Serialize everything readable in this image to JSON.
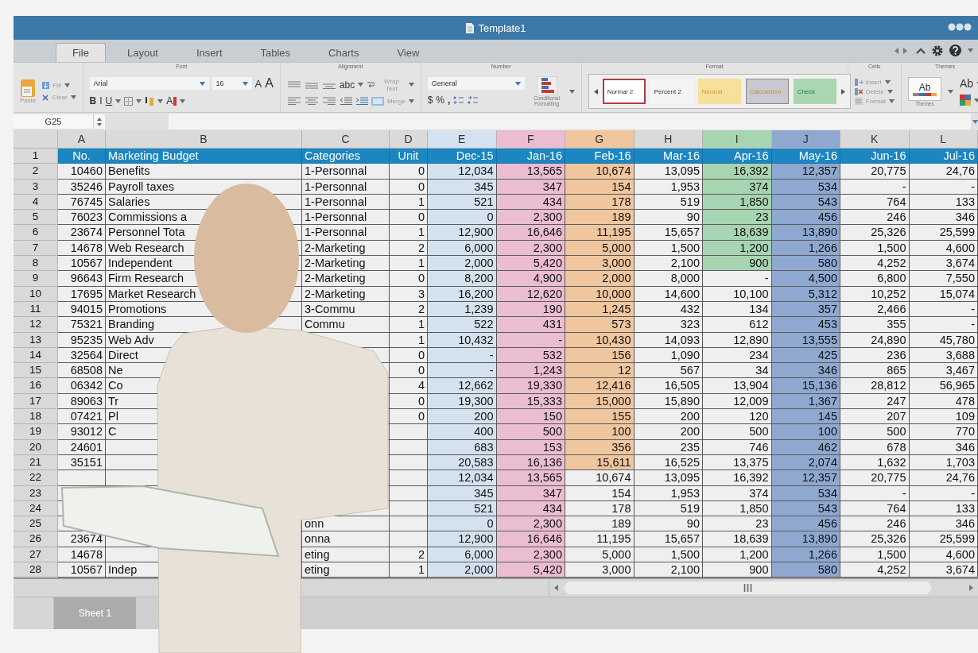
{
  "window": {
    "title": "Template1"
  },
  "tabs": [
    {
      "label": "File",
      "selected": true
    },
    {
      "label": "Layout",
      "selected": false
    },
    {
      "label": "Insert",
      "selected": false
    },
    {
      "label": "Tables",
      "selected": false
    },
    {
      "label": "Charts",
      "selected": false
    },
    {
      "label": "View",
      "selected": false
    }
  ],
  "ribbon": {
    "clipboard": {
      "paste": "Paste",
      "fill": "Fill",
      "clear": "Clear"
    },
    "font": {
      "label": "Font",
      "font_name": "Arial",
      "font_size": "16",
      "grow": "A",
      "shrink": "A",
      "bold": "B",
      "italic": "I",
      "underline": "U",
      "font_color": "A"
    },
    "alignment": {
      "label": "Alignment",
      "orientation": "abc",
      "wrap": "Wrap Text",
      "merge": "Merge"
    },
    "number": {
      "label": "Number",
      "format": "General",
      "currency": "$",
      "percent": "%",
      "comma": ",",
      "conditional": "Conditional Formatting"
    },
    "format": {
      "label": "Format",
      "styles": [
        {
          "name": "Normal 2",
          "kind": "normal",
          "selected": true
        },
        {
          "name": "Percent 2",
          "kind": "percent",
          "selected": false
        },
        {
          "name": "Neutral",
          "kind": "neutral",
          "selected": false
        },
        {
          "name": "Calculation",
          "kind": "calculation",
          "selected": false
        },
        {
          "name": "Check",
          "kind": "check",
          "selected": false
        }
      ]
    },
    "cells": {
      "label": "Cells",
      "insert": "Insert",
      "delete": "Delete",
      "format": "Format"
    },
    "themes": {
      "label": "Themes",
      "theme_sample": "Ab",
      "themes": "Themes",
      "fonts": "Ab"
    }
  },
  "formula_bar": {
    "name_box": "G25"
  },
  "sheet": {
    "columns": [
      {
        "letter": "A",
        "kind": "number"
      },
      {
        "letter": "B",
        "kind": "text"
      },
      {
        "letter": "C",
        "kind": "text"
      },
      {
        "letter": "D",
        "kind": "number"
      },
      {
        "letter": "E",
        "kind": "number",
        "color": "#d3e2ee"
      },
      {
        "letter": "F",
        "kind": "number",
        "color": "#ebbdd2"
      },
      {
        "letter": "G",
        "kind": "number",
        "color": "#f0c69e"
      },
      {
        "letter": "H",
        "kind": "number"
      },
      {
        "letter": "I",
        "kind": "number",
        "color": "#a8d5b1"
      },
      {
        "letter": "J",
        "kind": "number",
        "color": "#8ea8d0"
      },
      {
        "letter": "K",
        "kind": "number"
      },
      {
        "letter": "L",
        "kind": "number"
      }
    ],
    "rows": [
      {
        "label": "1",
        "cells": [
          "No.",
          "Marketing Budget",
          "Categories",
          "Unit",
          "Dec-15",
          "Jan-16",
          "Feb-16",
          "Mar-16",
          "Apr-16",
          "May-16",
          "Jun-16",
          "Jul-16"
        ]
      },
      {
        "label": "2",
        "cells": [
          "10460",
          "Benefits",
          "1-Personnal",
          "0",
          "12,034",
          "13,565",
          "10,674",
          "13,095",
          "16,392",
          "12,357",
          "20,775",
          "24,76"
        ],
        "tinted": [
          false,
          false,
          false,
          false,
          true,
          true,
          true,
          false,
          true,
          true,
          false,
          false
        ]
      },
      {
        "label": "3",
        "cells": [
          "35246",
          "Payroll taxes",
          "1-Personnal",
          "0",
          "345",
          "347",
          "154",
          "1,953",
          "374",
          "534",
          "-",
          "-"
        ],
        "tinted": [
          false,
          false,
          false,
          false,
          true,
          true,
          true,
          false,
          true,
          true,
          false,
          false
        ]
      },
      {
        "label": "4",
        "cells": [
          "76745",
          "Salaries",
          "1-Personnal",
          "1",
          "521",
          "434",
          "178",
          "519",
          "1,850",
          "543",
          "764",
          "133"
        ],
        "tinted": [
          false,
          false,
          false,
          false,
          true,
          true,
          true,
          false,
          true,
          true,
          false,
          false
        ]
      },
      {
        "label": "5",
        "cells": [
          "76023",
          "Commissions a",
          "1-Personnal",
          "0",
          "0",
          "2,300",
          "189",
          "90",
          "23",
          "456",
          "246",
          "346"
        ],
        "tinted": [
          false,
          false,
          false,
          false,
          true,
          true,
          true,
          false,
          true,
          true,
          false,
          false
        ]
      },
      {
        "label": "6",
        "cells": [
          "23674",
          "Personnel Tota",
          "1-Personnal",
          "1",
          "12,900",
          "16,646",
          "11,195",
          "15,657",
          "18,639",
          "13,890",
          "25,326",
          "25,599"
        ],
        "tinted": [
          false,
          false,
          false,
          false,
          true,
          true,
          true,
          false,
          true,
          true,
          false,
          false
        ]
      },
      {
        "label": "7",
        "cells": [
          "14678",
          "Web Research",
          "2-Marketing",
          "2",
          "6,000",
          "2,300",
          "5,000",
          "1,500",
          "1,200",
          "1,266",
          "1,500",
          "4,600"
        ],
        "tinted": [
          false,
          false,
          false,
          false,
          true,
          true,
          true,
          false,
          true,
          true,
          false,
          false
        ]
      },
      {
        "label": "8",
        "cells": [
          "10567",
          "Independent",
          "2-Marketing",
          "1",
          "2,000",
          "5,420",
          "3,000",
          "2,100",
          "900",
          "580",
          "4,252",
          "3,674"
        ],
        "tinted": [
          false,
          false,
          false,
          false,
          true,
          true,
          true,
          false,
          true,
          true,
          false,
          false
        ]
      },
      {
        "label": "9",
        "cells": [
          "96643",
          "Firm Research",
          "2-Marketing",
          "0",
          "8,200",
          "4,900",
          "2,000",
          "8,000",
          "-",
          "4,500",
          "6,800",
          "7,550"
        ],
        "tinted": [
          false,
          false,
          false,
          false,
          true,
          true,
          true,
          false,
          false,
          true,
          false,
          false
        ]
      },
      {
        "label": "10",
        "cells": [
          "17695",
          "Market Research",
          "2-Marketing",
          "3",
          "16,200",
          "12,620",
          "10,000",
          "14,600",
          "10,100",
          "5,312",
          "10,252",
          "15,074"
        ],
        "tinted": [
          false,
          false,
          false,
          false,
          true,
          true,
          true,
          false,
          false,
          true,
          false,
          false
        ]
      },
      {
        "label": "11",
        "cells": [
          "94015",
          "Promotions",
          "3-Commu",
          "2",
          "1,239",
          "190",
          "1,245",
          "432",
          "134",
          "357",
          "2,466",
          "-"
        ],
        "tinted": [
          false,
          false,
          false,
          false,
          true,
          true,
          true,
          false,
          false,
          true,
          false,
          false
        ]
      },
      {
        "label": "12",
        "cells": [
          "75321",
          "Branding",
          "Commu",
          "1",
          "522",
          "431",
          "573",
          "323",
          "612",
          "453",
          "355",
          "-"
        ],
        "tinted": [
          false,
          false,
          false,
          false,
          true,
          true,
          true,
          false,
          false,
          true,
          false,
          false
        ]
      },
      {
        "label": "13",
        "cells": [
          "95235",
          "Web Adv",
          null,
          "1",
          "10,432",
          "-",
          "10,430",
          "14,093",
          "12,890",
          "13,555",
          "24,890",
          "45,780"
        ],
        "tinted": [
          false,
          false,
          false,
          false,
          true,
          true,
          true,
          false,
          false,
          true,
          false,
          false
        ]
      },
      {
        "label": "14",
        "cells": [
          "32564",
          "Direct",
          null,
          "0",
          "-",
          "532",
          "156",
          "1,090",
          "234",
          "425",
          "236",
          "3,688"
        ],
        "tinted": [
          false,
          false,
          false,
          false,
          true,
          true,
          true,
          false,
          false,
          true,
          false,
          false
        ]
      },
      {
        "label": "15",
        "cells": [
          "68508",
          "Ne",
          null,
          "0",
          "-",
          "1,243",
          "12",
          "567",
          "34",
          "346",
          "865",
          "3,467"
        ],
        "tinted": [
          false,
          false,
          false,
          false,
          true,
          true,
          true,
          false,
          false,
          true,
          false,
          false
        ]
      },
      {
        "label": "16",
        "cells": [
          "06342",
          "Co",
          null,
          "4",
          "12,662",
          "19,330",
          "12,416",
          "16,505",
          "13,904",
          "15,136",
          "28,812",
          "56,965"
        ],
        "tinted": [
          false,
          false,
          false,
          false,
          true,
          true,
          true,
          false,
          false,
          true,
          false,
          false
        ]
      },
      {
        "label": "17",
        "cells": [
          "89063",
          "Tr",
          null,
          "0",
          "19,300",
          "15,333",
          "15,000",
          "15,890",
          "12,009",
          "1,367",
          "247",
          "478"
        ],
        "tinted": [
          false,
          false,
          false,
          false,
          true,
          true,
          true,
          false,
          false,
          true,
          false,
          false
        ]
      },
      {
        "label": "18",
        "cells": [
          "07421",
          "Pl",
          null,
          "0",
          "200",
          "150",
          "155",
          "200",
          "120",
          "145",
          "207",
          "109"
        ],
        "tinted": [
          false,
          false,
          false,
          false,
          true,
          true,
          true,
          false,
          false,
          true,
          false,
          false
        ]
      },
      {
        "label": "19",
        "cells": [
          "93012",
          "C",
          null,
          null,
          "400",
          "500",
          "100",
          "200",
          "500",
          "100",
          "500",
          "770"
        ],
        "tinted": [
          false,
          false,
          false,
          false,
          true,
          true,
          true,
          false,
          false,
          true,
          false,
          false
        ]
      },
      {
        "label": "20",
        "cells": [
          "24601",
          null,
          null,
          null,
          "683",
          "153",
          "356",
          "235",
          "746",
          "462",
          "678",
          "346"
        ],
        "tinted": [
          false,
          false,
          false,
          false,
          true,
          true,
          true,
          false,
          false,
          true,
          false,
          false
        ]
      },
      {
        "label": "21",
        "cells": [
          "35151",
          null,
          null,
          null,
          "20,583",
          "16,136",
          "15,611",
          "16,525",
          "13,375",
          "2,074",
          "1,632",
          "1,703"
        ],
        "tinted": [
          false,
          false,
          false,
          false,
          true,
          true,
          true,
          false,
          false,
          true,
          false,
          false
        ]
      },
      {
        "label": "22",
        "cells": [
          null,
          null,
          null,
          null,
          "12,034",
          "13,565",
          "10,674",
          "13,095",
          "16,392",
          "12,357",
          "20,775",
          "24,76"
        ],
        "tinted": [
          false,
          false,
          false,
          false,
          true,
          true,
          false,
          false,
          false,
          true,
          false,
          false
        ]
      },
      {
        "label": "23",
        "cells": [
          null,
          null,
          null,
          null,
          "345",
          "347",
          "154",
          "1,953",
          "374",
          "534",
          "-",
          "-"
        ],
        "tinted": [
          false,
          false,
          false,
          false,
          true,
          true,
          false,
          false,
          false,
          true,
          false,
          false
        ]
      },
      {
        "label": "24",
        "cells": [
          null,
          null,
          null,
          null,
          "521",
          "434",
          "178",
          "519",
          "1,850",
          "543",
          "764",
          "133"
        ],
        "tinted": [
          false,
          false,
          false,
          false,
          true,
          true,
          false,
          false,
          false,
          true,
          false,
          false
        ]
      },
      {
        "label": "25",
        "cells": [
          null,
          null,
          "onn",
          null,
          "0",
          "2,300",
          "189",
          "90",
          "23",
          "456",
          "246",
          "346"
        ],
        "tinted": [
          false,
          false,
          false,
          false,
          true,
          true,
          false,
          false,
          false,
          true,
          false,
          false
        ]
      },
      {
        "label": "26",
        "cells": [
          "23674",
          null,
          "onna",
          null,
          "12,900",
          "16,646",
          "11,195",
          "15,657",
          "18,639",
          "13,890",
          "25,326",
          "25,599"
        ],
        "tinted": [
          false,
          false,
          false,
          false,
          true,
          true,
          false,
          false,
          false,
          true,
          false,
          false
        ]
      },
      {
        "label": "27",
        "cells": [
          "14678",
          null,
          "eting",
          "2",
          "6,000",
          "2,300",
          "5,000",
          "1,500",
          "1,200",
          "1,266",
          "1,500",
          "4,600"
        ],
        "tinted": [
          false,
          false,
          false,
          false,
          true,
          true,
          false,
          false,
          false,
          true,
          false,
          false
        ]
      },
      {
        "label": "28",
        "cells": [
          "10567",
          "Indep",
          "eting",
          "1",
          "2,000",
          "5,420",
          "3,000",
          "2,100",
          "900",
          "580",
          "4,252",
          "3,674"
        ],
        "tinted": [
          false,
          false,
          false,
          false,
          true,
          true,
          false,
          false,
          false,
          true,
          false,
          false
        ]
      }
    ]
  },
  "sheet_tabs": [
    {
      "label": "Sheet 1",
      "selected": true
    }
  ]
}
